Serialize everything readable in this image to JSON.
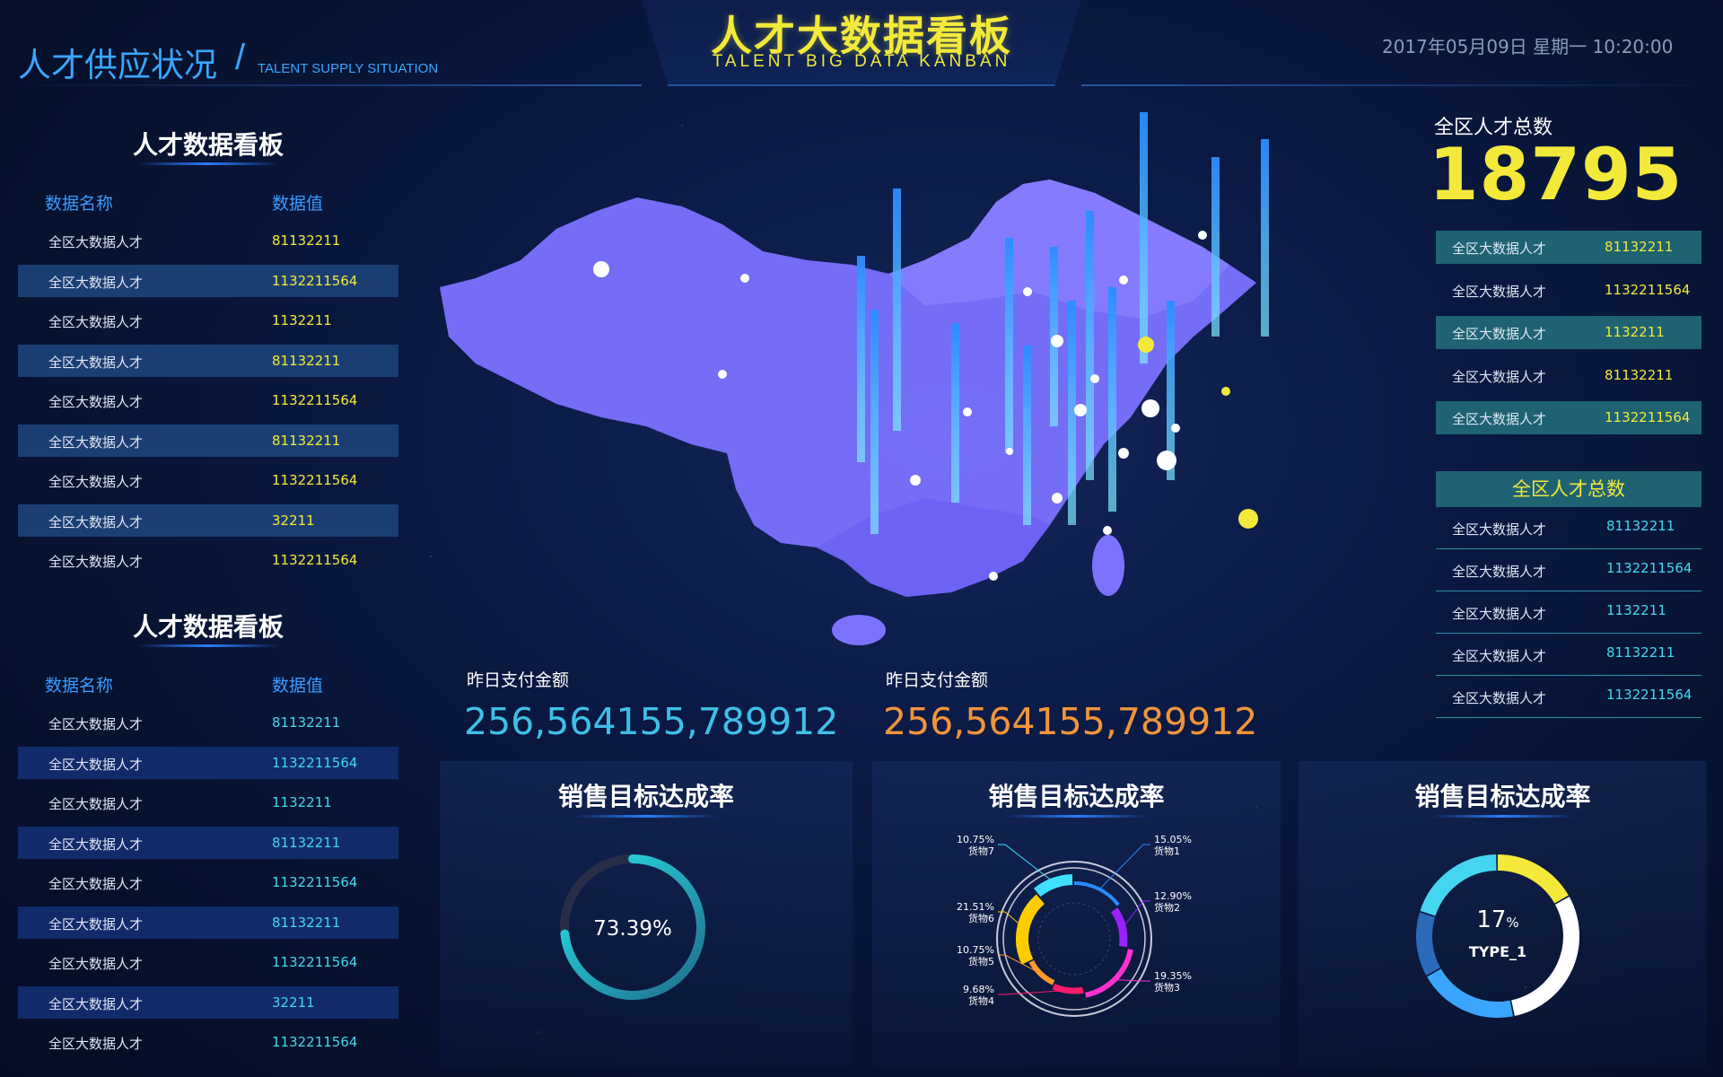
{
  "header": {
    "title": "人才大数据看板",
    "subtitle": "TALENT BIG DATA KANBAN",
    "section_title": "人才供应状况",
    "section_subtitle": "TALENT SUPPLY SITUATION",
    "datetime": "2017年05月09日 星期一 10:20:00"
  },
  "left_panels": [
    {
      "title": "人才数据看板",
      "col_name": "数据名称",
      "col_value": "数据值",
      "rows": [
        {
          "name": "全区大数据人才",
          "value": "81132211"
        },
        {
          "name": "全区大数据人才",
          "value": "1132211564"
        },
        {
          "name": "全区大数据人才",
          "value": "1132211"
        },
        {
          "name": "全区大数据人才",
          "value": "81132211"
        },
        {
          "name": "全区大数据人才",
          "value": "1132211564"
        },
        {
          "name": "全区大数据人才",
          "value": "81132211"
        },
        {
          "name": "全区大数据人才",
          "value": "1132211564"
        },
        {
          "name": "全区大数据人才",
          "value": "32211"
        },
        {
          "name": "全区大数据人才",
          "value": "1132211564"
        }
      ]
    },
    {
      "title": "人才数据看板",
      "col_name": "数据名称",
      "col_value": "数据值",
      "rows": [
        {
          "name": "全区大数据人才",
          "value": "81132211"
        },
        {
          "name": "全区大数据人才",
          "value": "1132211564"
        },
        {
          "name": "全区大数据人才",
          "value": "1132211"
        },
        {
          "name": "全区大数据人才",
          "value": "81132211"
        },
        {
          "name": "全区大数据人才",
          "value": "1132211564"
        },
        {
          "name": "全区大数据人才",
          "value": "81132211"
        },
        {
          "name": "全区大数据人才",
          "value": "1132211564"
        },
        {
          "name": "全区大数据人才",
          "value": "32211"
        },
        {
          "name": "全区大数据人才",
          "value": "1132211564"
        }
      ]
    }
  ],
  "center_stats": [
    {
      "label": "昨日支付金额",
      "value": "256,564155,789912",
      "color": "#3ec0e6"
    },
    {
      "label": "昨日支付金额",
      "value": "256,564155,789912",
      "color": "#f0953a"
    }
  ],
  "right": {
    "total_label": "全区人才总数",
    "total_value": "18795",
    "table1": [
      {
        "name": "全区大数据人才",
        "value": "81132211"
      },
      {
        "name": "全区大数据人才",
        "value": "1132211564"
      },
      {
        "name": "全区大数据人才",
        "value": "1132211"
      },
      {
        "name": "全区大数据人才",
        "value": "81132211"
      },
      {
        "name": "全区大数据人才",
        "value": "1132211564"
      }
    ],
    "table2_title": "全区人才总数",
    "table2": [
      {
        "name": "全区大数据人才",
        "value": "81132211"
      },
      {
        "name": "全区大数据人才",
        "value": "1132211564"
      },
      {
        "name": "全区大数据人才",
        "value": "1132211"
      },
      {
        "name": "全区大数据人才",
        "value": "81132211"
      },
      {
        "name": "全区大数据人才",
        "value": "1132211564"
      }
    ]
  },
  "bottom_panels": [
    {
      "title": "销售目标达成率"
    },
    {
      "title": "销售目标达成率"
    },
    {
      "title": "销售目标达成率"
    }
  ],
  "colors": {
    "accent_yellow": "#f2e93a",
    "accent_blue": "#3aa6ff",
    "accent_cyan": "#44d6f0",
    "map_fill": "#7b72ff"
  },
  "chart_data": [
    {
      "type": "gauge",
      "label": "73.39%",
      "value": 73.39,
      "max": 100
    },
    {
      "type": "pie",
      "categories": [
        "货物1",
        "货物2",
        "货物3",
        "货物4",
        "货物5",
        "货物6",
        "货物7"
      ],
      "values": [
        15.05,
        12.9,
        19.35,
        9.68,
        10.75,
        21.51,
        10.75
      ],
      "labels": [
        "15.05%",
        "12.90%",
        "19.35%",
        "9.68%",
        "10.75%",
        "21.51%",
        "10.75%"
      ],
      "colors": [
        "#2a8cff",
        "#9a22ff",
        "#ff2fd0",
        "#ff1a6c",
        "#ff9a2a",
        "#ffcc00",
        "#3fe0ff"
      ]
    },
    {
      "type": "pie",
      "label_value": "17",
      "label_unit": "%",
      "label_name": "TYPE_1",
      "values": [
        17,
        30,
        20,
        13,
        20
      ],
      "colors": [
        "#f2e93a",
        "#ffffff",
        "#3aa6ff",
        "#2a6ab8",
        "#44d6f0"
      ]
    }
  ]
}
